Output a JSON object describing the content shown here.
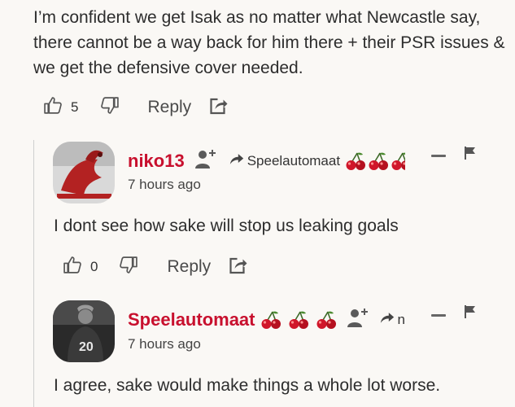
{
  "parent": {
    "text": "I’m confident we get Isak as no matter what Newcastle say, there cannot be a way back for him there + their PSR issues & we get the defensive cover needed.",
    "likes": "5",
    "reply_label": "Reply"
  },
  "comments": [
    {
      "username": "niko13",
      "reply_to": "Speelautomaat",
      "time": "7 hours ago",
      "text": "I dont see how sake will stop us leaking goals",
      "likes": "0",
      "reply_label": "Reply"
    },
    {
      "username": "Speelautomaat",
      "reply_to": "n",
      "time": "7 hours ago",
      "text": "I agree, sake would make things a whole lot worse.",
      "avatar_number": "20"
    }
  ],
  "colors": {
    "username": "#c8102e",
    "background": "#faf8f5",
    "icon": "#555555"
  },
  "icons": [
    "thumbs-up-icon",
    "thumbs-down-icon",
    "share-icon",
    "add-user-icon",
    "reply-arrow-icon",
    "cherry-icon",
    "collapse-icon",
    "flag-icon"
  ]
}
